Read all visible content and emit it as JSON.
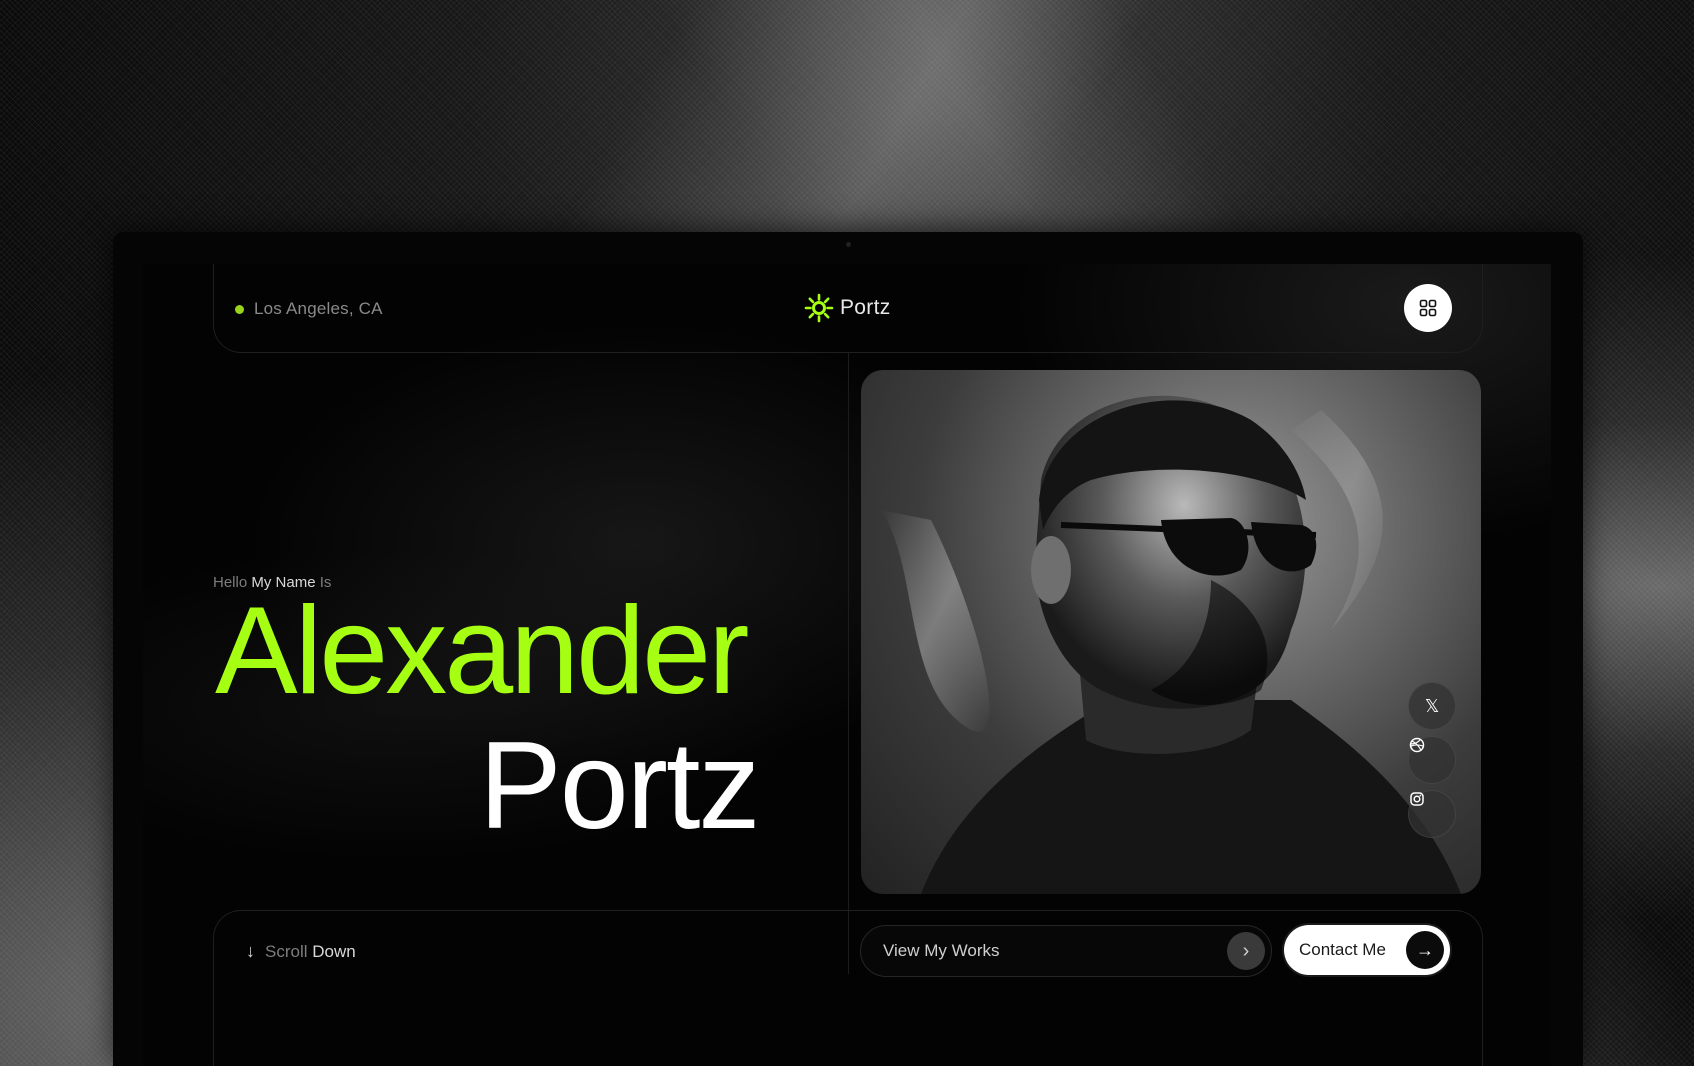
{
  "colors": {
    "accent": "#a6ff12",
    "location_dot": "#9ad41a",
    "background": "#030303",
    "text_light": "#ffffff",
    "text_muted": "#7d7d7d"
  },
  "header": {
    "location": "Los Angeles, CA",
    "brand_name": "Portz",
    "brand_icon": "sun-burst-icon",
    "menu_icon": "grid-icon"
  },
  "hero": {
    "greeting_pre": "Hello",
    "greeting_highlight": "My Name",
    "greeting_post": "Is",
    "first_name": "Alexander",
    "last_name": "Portz"
  },
  "portrait": {
    "alt": "portrait"
  },
  "social": {
    "x_icon": "x-twitter-icon",
    "x_glyph": "𝕏",
    "dribbble_icon": "dribbble-icon",
    "instagram_icon": "instagram-icon"
  },
  "footer": {
    "scroll_arrow": "↓",
    "scroll_pre": "Scroll",
    "scroll_highlight": "Down",
    "view_works_label": "View My Works",
    "view_works_arrow": "›",
    "contact_label": "Contact Me",
    "contact_arrow": "→"
  }
}
